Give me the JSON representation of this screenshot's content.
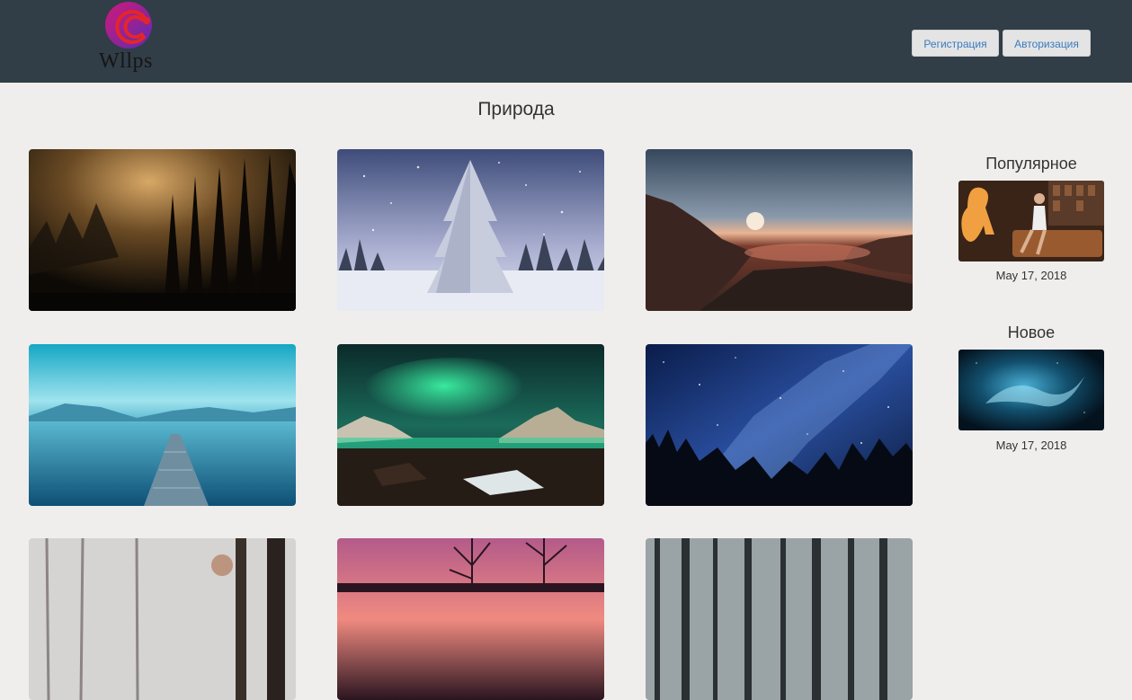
{
  "header": {
    "logo_text": "Wllps",
    "brand_colors": {
      "gradient_start": "#c2147e",
      "gradient_end": "#5a2db0",
      "accent": "#e4262a"
    },
    "buttons": {
      "register": "Регистрация",
      "login": "Авторизация"
    }
  },
  "main": {
    "title": "Природа",
    "wallpapers": [
      {
        "icon": "foggy-forest-image"
      },
      {
        "icon": "snowy-fir-image"
      },
      {
        "icon": "sunset-lake-image"
      },
      {
        "icon": "blue-lake-pier-image"
      },
      {
        "icon": "aurora-image"
      },
      {
        "icon": "milky-way-image"
      },
      {
        "icon": "misty-winter-forest-image"
      },
      {
        "icon": "pink-sunset-trees-image"
      },
      {
        "icon": "dark-forest-image"
      }
    ]
  },
  "sidebar": {
    "popular": {
      "heading": "Популярное",
      "date": "May 17, 2018",
      "icon": "popular-wallpaper-image"
    },
    "new": {
      "heading": "Новое",
      "date": "May 17, 2018",
      "icon": "new-wallpaper-image"
    }
  }
}
